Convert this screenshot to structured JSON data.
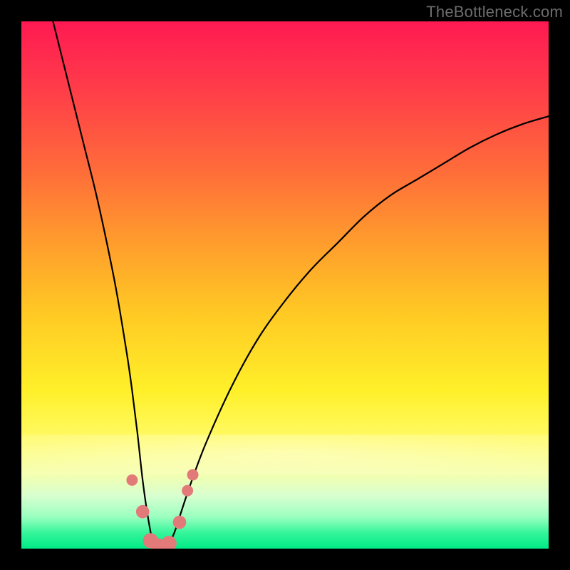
{
  "watermark": "TheBottleneck.com",
  "chart_data": {
    "type": "line",
    "title": "",
    "xlabel": "",
    "ylabel": "",
    "xlim": [
      0,
      100
    ],
    "ylim": [
      0,
      100
    ],
    "grid": false,
    "legend": false,
    "background_gradient": {
      "stops": [
        {
          "pos": 0,
          "color": "#ff1a52"
        },
        {
          "pos": 28,
          "color": "#ff6b3a"
        },
        {
          "pos": 55,
          "color": "#ffc824"
        },
        {
          "pos": 80,
          "color": "#fffb6a"
        },
        {
          "pos": 97,
          "color": "#35f59a"
        },
        {
          "pos": 100,
          "color": "#00ea86"
        }
      ]
    },
    "series": [
      {
        "name": "bottleneck-curve",
        "color": "#000000",
        "x": [
          6,
          8,
          10,
          12,
          14,
          16,
          18,
          20,
          21,
          22,
          23,
          24,
          25,
          26,
          27,
          28,
          29,
          30,
          32,
          35,
          40,
          45,
          50,
          55,
          60,
          65,
          70,
          75,
          80,
          85,
          90,
          95,
          100
        ],
        "y": [
          100,
          92,
          84,
          76,
          68,
          59,
          49,
          37,
          30,
          22,
          13,
          6,
          1,
          0,
          0,
          1,
          3,
          6,
          12,
          20,
          31,
          40,
          47,
          53,
          58,
          63,
          67,
          70,
          73,
          76,
          78.5,
          80.5,
          82
        ]
      }
    ],
    "markers": [
      {
        "name": "left-dot",
        "x": 21.0,
        "y": 13.0,
        "r": 1.2,
        "color": "#e27a7a"
      },
      {
        "name": "left-lower-dot",
        "x": 23.0,
        "y": 7.0,
        "r": 1.4,
        "color": "#e27a7a"
      },
      {
        "name": "trough-left",
        "x": 24.5,
        "y": 1.5,
        "r": 1.6,
        "color": "#e27a7a"
      },
      {
        "name": "trough-mid",
        "x": 26.0,
        "y": 0.5,
        "r": 1.6,
        "color": "#e27a7a"
      },
      {
        "name": "trough-right",
        "x": 28.0,
        "y": 1.0,
        "r": 1.6,
        "color": "#e27a7a"
      },
      {
        "name": "right-lower-dot",
        "x": 30.0,
        "y": 5.0,
        "r": 1.4,
        "color": "#e27a7a"
      },
      {
        "name": "right-dot-a",
        "x": 31.5,
        "y": 11.0,
        "r": 1.2,
        "color": "#e27a7a"
      },
      {
        "name": "right-dot-b",
        "x": 32.5,
        "y": 14.0,
        "r": 1.2,
        "color": "#e27a7a"
      }
    ]
  }
}
